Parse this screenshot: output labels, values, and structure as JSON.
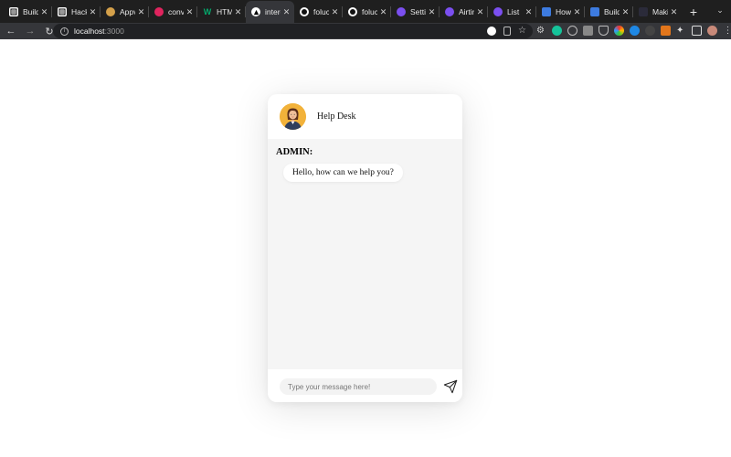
{
  "browser": {
    "tabs": [
      {
        "title": "Build",
        "icon": "notion-icon",
        "active": false
      },
      {
        "title": "Hack",
        "icon": "notion-icon",
        "active": false
      },
      {
        "title": "Appv",
        "icon": "appwrite-icon",
        "active": false
      },
      {
        "title": "conv",
        "icon": "app-icon",
        "active": false
      },
      {
        "title": "HTML",
        "icon": "w3schools-icon",
        "active": false
      },
      {
        "title": "interc",
        "icon": "triangle-icon",
        "active": true
      },
      {
        "title": "foluc",
        "icon": "github-icon",
        "active": false
      },
      {
        "title": "foluc",
        "icon": "github-icon",
        "active": false
      },
      {
        "title": "Settin",
        "icon": "supabase-icon",
        "active": false
      },
      {
        "title": "Airtin",
        "icon": "supabase-icon",
        "active": false
      },
      {
        "title": "List",
        "icon": "supabase-icon",
        "active": false
      },
      {
        "title": "How",
        "icon": "stack-icon",
        "active": false
      },
      {
        "title": "Build",
        "icon": "stack-icon",
        "active": false
      },
      {
        "title": "Maki",
        "icon": "dark-icon",
        "active": false
      }
    ],
    "address": {
      "host": "localhost",
      "port": ":3000"
    }
  },
  "chat": {
    "title": "Help Desk",
    "messages": [
      {
        "sender": "ADMIN:",
        "text": "Hello, how can we help you?"
      }
    ],
    "input_placeholder": "Type your message here!",
    "input_value": ""
  },
  "colors": {
    "chrome_dark": "#1f1f1f",
    "toolbar": "#35363a",
    "chat_body": "#f5f5f5",
    "avatar_bg": "#f2b23a"
  }
}
